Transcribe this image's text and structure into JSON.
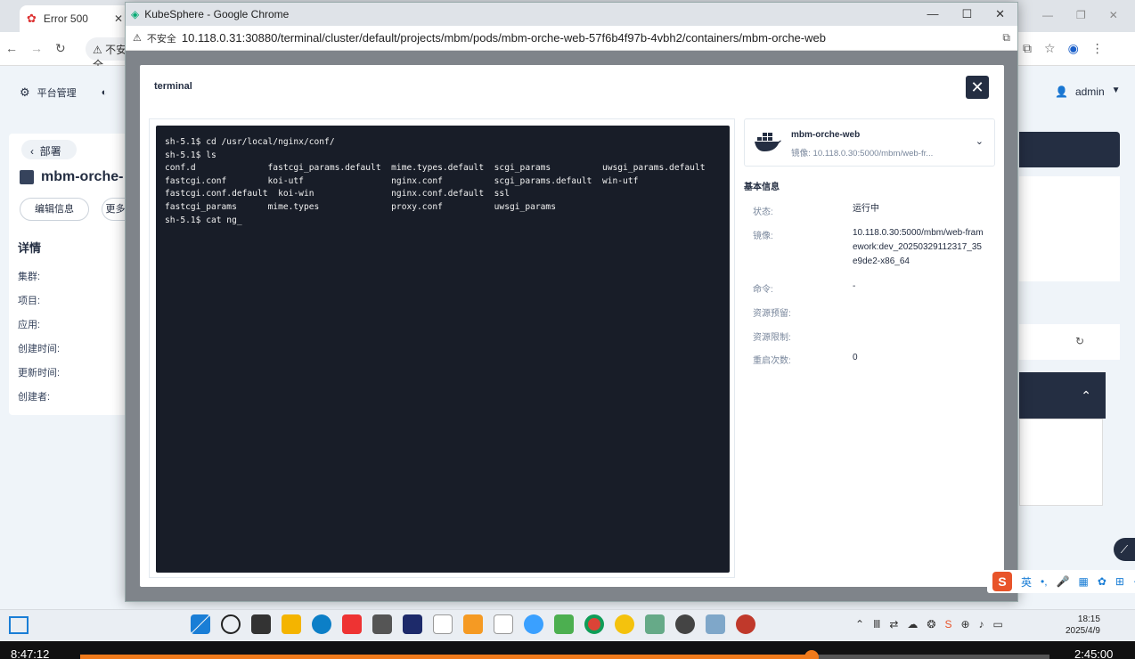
{
  "bg_browser": {
    "tab_title": "Error 500",
    "addr_prefix": "不安全"
  },
  "bg_page": {
    "platform_label": "平台管理",
    "user_name": "admin",
    "back_label": "部署",
    "resource_name": "mbm-orche-",
    "edit_button": "编辑信息",
    "more_button": "更多",
    "detail_title": "详情",
    "detail_rows": [
      "集群:",
      "项目:",
      "应用:",
      "创建时间:",
      "更新时间:",
      "创建者:"
    ]
  },
  "window": {
    "title": "KubeSphere - Google Chrome",
    "security_label": "不安全",
    "url": "10.118.0.31:30880/terminal/cluster/default/projects/mbm/pods/mbm-orche-web-57f6b4f97b-4vbh2/containers/mbm-orche-web"
  },
  "modal": {
    "title": "terminal",
    "terminal_text": "sh-5.1$ cd /usr/local/nginx/conf/\nsh-5.1$ ls\nconf.d              fastcgi_params.default  mime.types.default  scgi_params          uwsgi_params.default\nfastcgi.conf        koi-utf                 nginx.conf          scgi_params.default  win-utf\nfastcgi.conf.default  koi-win               nginx.conf.default  ssl\nfastcgi_params      mime.types              proxy.conf          uwsgi_params\nsh-5.1$ cat ng_",
    "container": {
      "name": "mbm-orche-web",
      "image_label": "镜像:",
      "image_short": "10.118.0.30:5000/mbm/web-fr..."
    },
    "info_title": "基本信息",
    "info": [
      {
        "label": "状态:",
        "value": "运行中"
      },
      {
        "label": "镜像:",
        "value": "10.118.0.30:5000/mbm/web-framework:dev_20250329112317_35e9de2-x86_64"
      },
      {
        "label": "命令:",
        "value": "-"
      },
      {
        "label": "资源预留:",
        "value": ""
      },
      {
        "label": "资源限制:",
        "value": ""
      },
      {
        "label": "重启次数:",
        "value": "0"
      }
    ]
  },
  "taskbar": {
    "time": "18:15",
    "date": "2025/4/9",
    "ime_label": "英"
  },
  "video": {
    "current": "8:47:12",
    "total": "2:45:00",
    "progress": 0.755
  },
  "colors": {
    "terminal_bg": "#181d28",
    "ks_dark": "#242e42",
    "progress": "#f07a1a"
  }
}
